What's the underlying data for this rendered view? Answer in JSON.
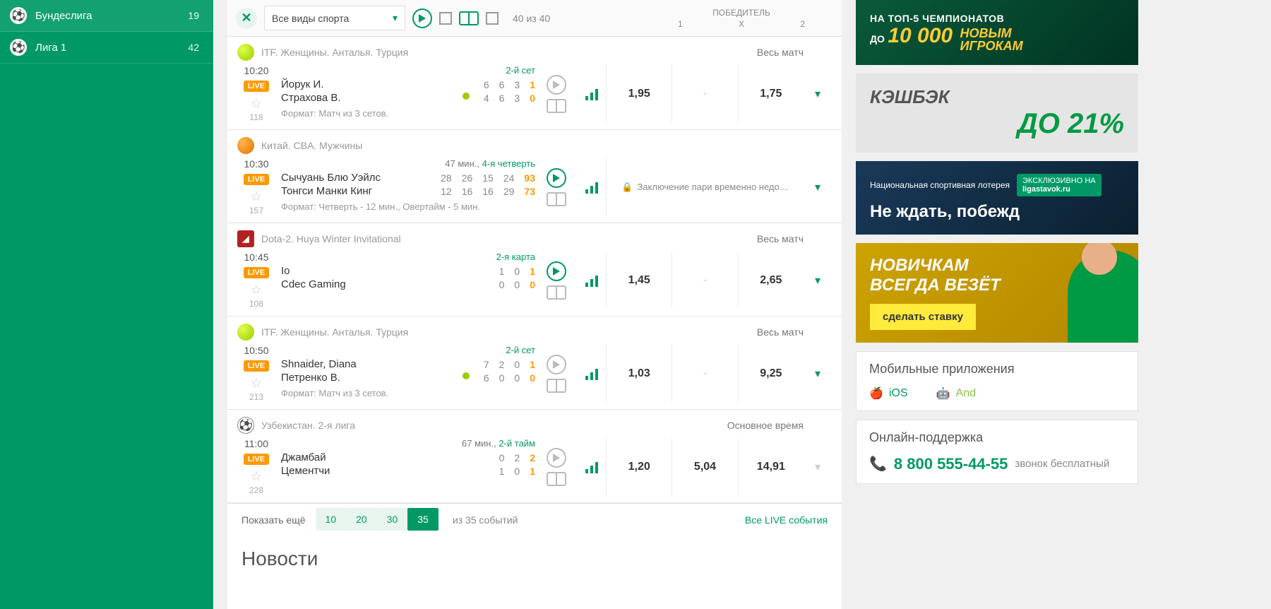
{
  "sidebar": {
    "items": [
      {
        "label": "Бундеслига",
        "count": 19
      },
      {
        "label": "Лига 1",
        "count": 42
      }
    ]
  },
  "filter": {
    "sport_select": "Все виды спорта",
    "count": "40 из 40",
    "winner_title": "ПОБЕДИТЕЛЬ",
    "col1": "1",
    "colx": "X",
    "col2": "2"
  },
  "events": [
    {
      "league": "ITF. Женщины. Анталья. Турция",
      "sport": "tennis",
      "scope": "Весь матч",
      "time": "10:20",
      "live": "LIVE",
      "num": "118",
      "phase": "2-й сет",
      "phase_time": "",
      "teams": [
        {
          "name": "Йорук И.",
          "scores": [
            "6",
            "6",
            "3",
            "1"
          ],
          "serving": false
        },
        {
          "name": "Страхова В.",
          "scores": [
            "4",
            "6",
            "3",
            "0"
          ],
          "serving": true
        }
      ],
      "format": "Формат: Матч из 3 сетов.",
      "odds": {
        "c1": "1,95",
        "cx": "-",
        "c2": "1,75"
      },
      "locked": false,
      "play_active": false,
      "expand": true
    },
    {
      "league": "Китай. CBA. Мужчины",
      "sport": "basket",
      "scope": "",
      "time": "10:30",
      "live": "LIVE",
      "num": "157",
      "phase": "4-я четверть",
      "phase_time": "47 мин., ",
      "teams": [
        {
          "name": "Сычуань Блю Уэйлс",
          "scores": [
            "28",
            "26",
            "15",
            "24",
            "93"
          ],
          "serving": false
        },
        {
          "name": "Тонгси Манки Кинг",
          "scores": [
            "12",
            "16",
            "16",
            "29",
            "73"
          ],
          "serving": false
        }
      ],
      "format": "Формат: Четверть - 12 мин., Овертайм - 5 мин.",
      "odds": {
        "locked_text": "Заключение пари временно недо…"
      },
      "locked": true,
      "play_active": true,
      "expand": true
    },
    {
      "league": "Dota-2. Huya Winter Invitational",
      "sport": "dota",
      "scope": "Весь матч",
      "time": "10:45",
      "live": "LIVE",
      "num": "108",
      "phase": "2-я карта",
      "phase_time": "",
      "teams": [
        {
          "name": "Io",
          "scores": [
            "1",
            "0",
            "1"
          ],
          "serving": false
        },
        {
          "name": "Cdec Gaming",
          "scores": [
            "0",
            "0",
            "0"
          ],
          "serving": false
        }
      ],
      "format": "",
      "odds": {
        "c1": "1,45",
        "cx": "-",
        "c2": "2,65"
      },
      "locked": false,
      "play_active": true,
      "expand": true
    },
    {
      "league": "ITF. Женщины. Анталья. Турция",
      "sport": "tennis",
      "scope": "Весь матч",
      "time": "10:50",
      "live": "LIVE",
      "num": "213",
      "phase": "2-й сет",
      "phase_time": "",
      "teams": [
        {
          "name": "Shnaider, Diana",
          "scores": [
            "7",
            "2",
            "0",
            "1"
          ],
          "serving": false
        },
        {
          "name": "Петренко В.",
          "scores": [
            "6",
            "0",
            "0",
            "0"
          ],
          "serving": true
        }
      ],
      "format": "Формат: Матч из 3 сетов.",
      "odds": {
        "c1": "1,03",
        "cx": "-",
        "c2": "9,25"
      },
      "locked": false,
      "play_active": false,
      "expand": true
    },
    {
      "league": "Узбекистан. 2-я лига",
      "sport": "soccer",
      "scope": "Основное время",
      "time": "11:00",
      "live": "LIVE",
      "num": "228",
      "phase": "2-й тайм",
      "phase_time": "67 мин., ",
      "teams": [
        {
          "name": "Джамбай",
          "scores": [
            "0",
            "2",
            "2"
          ],
          "serving": false
        },
        {
          "name": "Цементчи",
          "scores": [
            "1",
            "0",
            "1"
          ],
          "serving": false
        }
      ],
      "format": "",
      "odds": {
        "c1": "1,20",
        "cx": "5,04",
        "c2": "14,91"
      },
      "locked": false,
      "play_active": false,
      "expand": false
    }
  ],
  "pager": {
    "label": "Показать ещё",
    "pages": [
      "10",
      "20",
      "30",
      "35"
    ],
    "active": "35",
    "info": "из 35 событий",
    "all": "Все LIVE события"
  },
  "news_heading": "Новости",
  "banners": {
    "b1": {
      "l1": "НА ТОП-5 ЧЕМПИОНАТОВ",
      "pref": "ДО",
      "num": "10 000",
      "suf1": "НОВЫМ",
      "suf2": "ИГРОКАМ"
    },
    "b2": {
      "l1": "КЭШБЭК",
      "l2": "ДО 21%"
    },
    "b3": {
      "brand": "Национальная спортивная лотерея",
      "excl": "ЭКСКЛЮЗИВНО НА",
      "site": "ligastavok.ru",
      "l1": "Не ждать, побежд"
    },
    "b4": {
      "l1": "НОВИЧКАМ",
      "l2": "ВСЕГДА ВЕЗЁТ",
      "btn": "сделать ставку"
    }
  },
  "apps": {
    "title": "Мобильные приложения",
    "ios": "iOS",
    "android": "And"
  },
  "support": {
    "title": "Онлайн-поддержка",
    "phone": "8 800 555-44-55",
    "free": "звонок бесплатный"
  }
}
